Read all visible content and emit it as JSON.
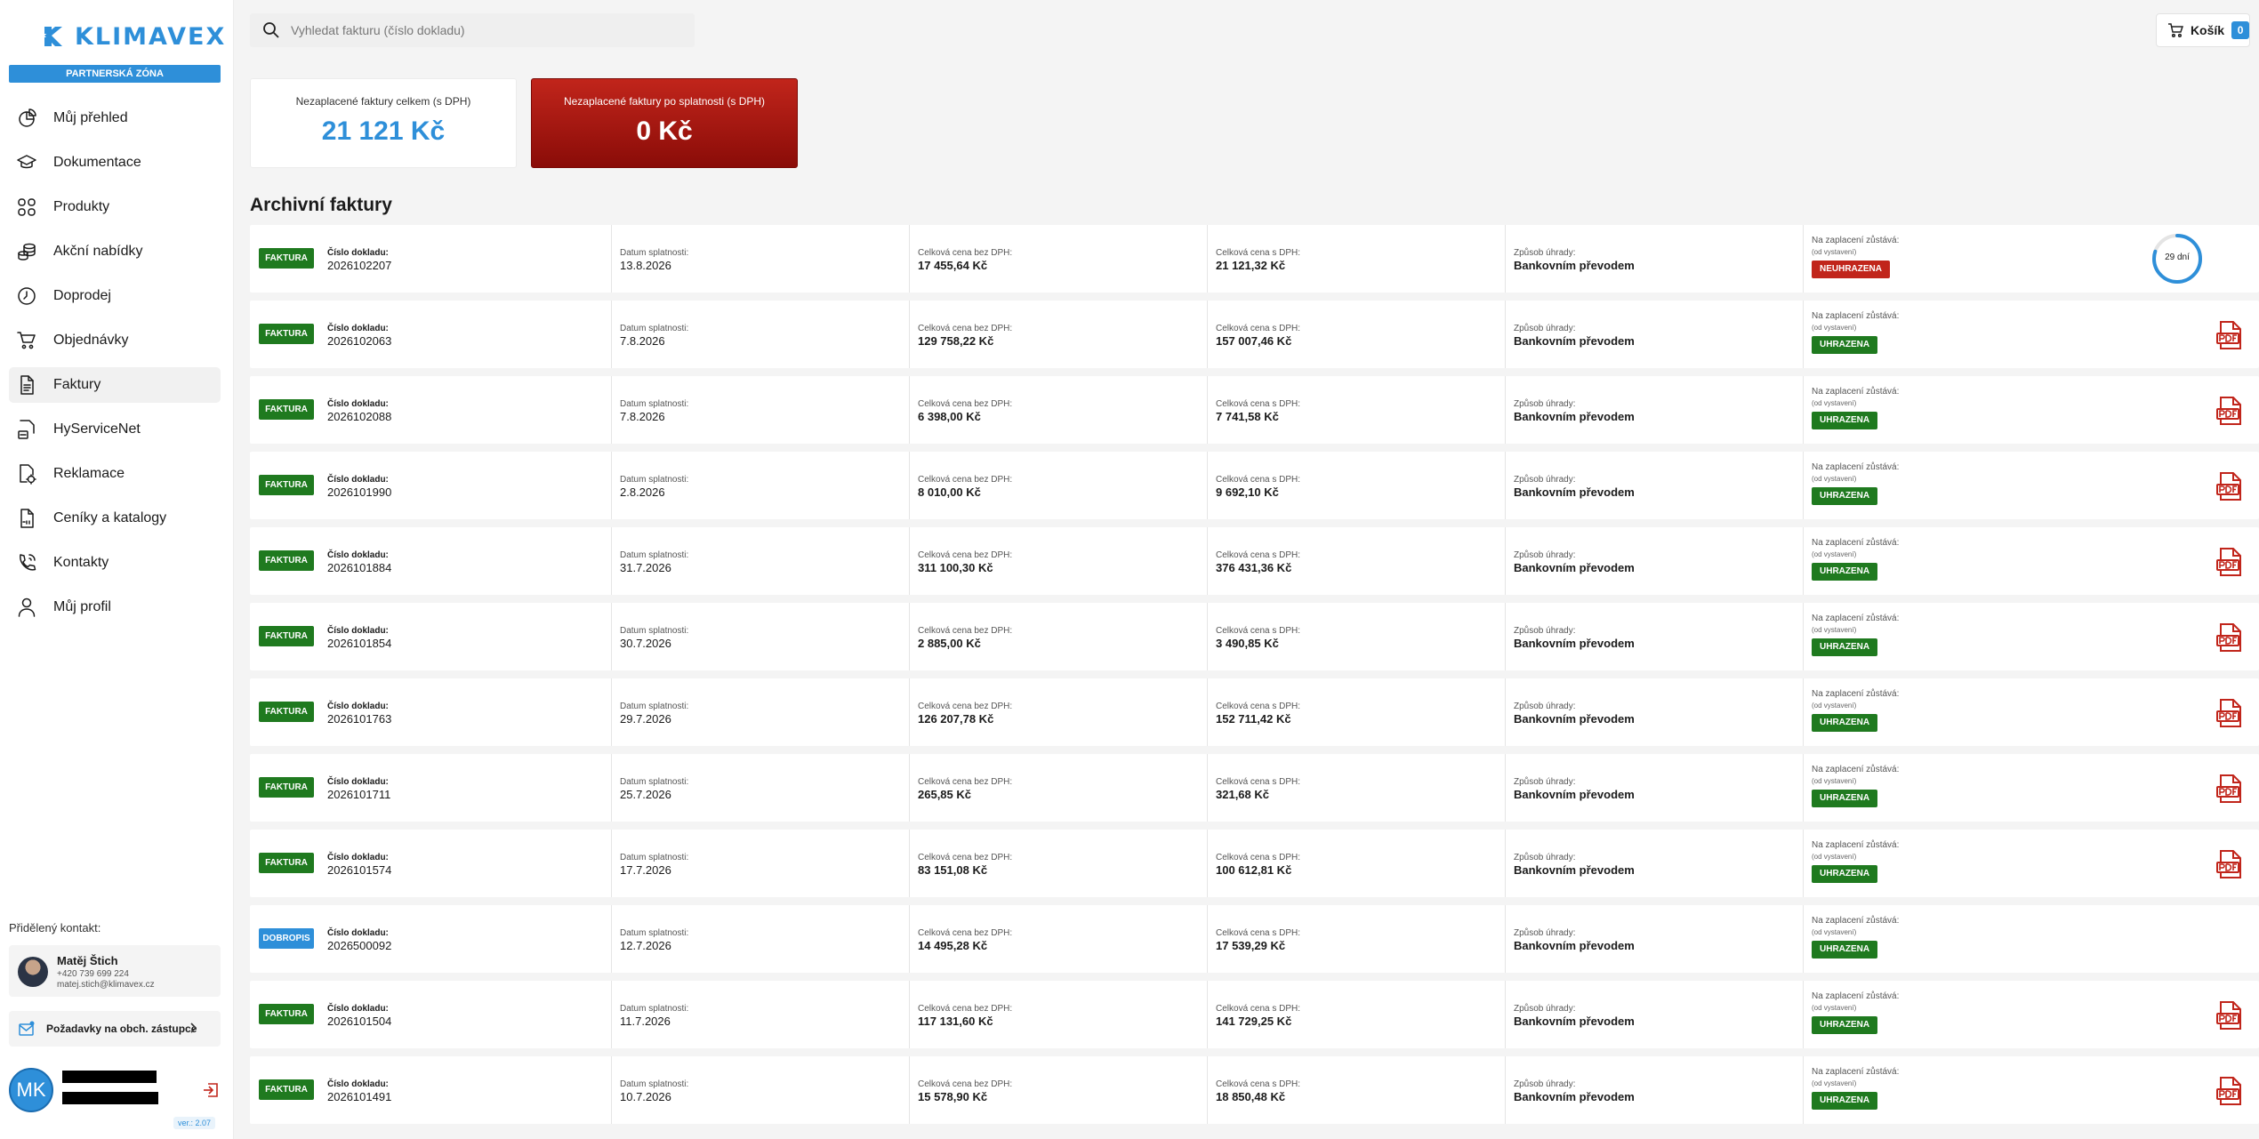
{
  "brand": {
    "name": "KLIMAVEX",
    "zone": "PARTNERSKÁ ZÓNA",
    "accent": "#2e8fd9"
  },
  "nav": [
    {
      "id": "prehled",
      "label": "Můj přehled",
      "icon": "chart-pie-icon"
    },
    {
      "id": "dokumentace",
      "label": "Dokumentace",
      "icon": "graduation-cap-icon"
    },
    {
      "id": "produkty",
      "label": "Produkty",
      "icon": "grid-icon"
    },
    {
      "id": "akce",
      "label": "Akční nabídky",
      "icon": "coins-icon"
    },
    {
      "id": "doprodej",
      "label": "Doprodej",
      "icon": "clock-icon"
    },
    {
      "id": "objednavky",
      "label": "Objednávky",
      "icon": "cart-icon"
    },
    {
      "id": "faktury",
      "label": "Faktury",
      "icon": "document-icon"
    },
    {
      "id": "hyservicenet",
      "label": "HyServiceNet",
      "icon": "globe-icon"
    },
    {
      "id": "reklamace",
      "label": "Reklamace",
      "icon": "document-gear-icon"
    },
    {
      "id": "ceniky",
      "label": "Ceníky a katalogy",
      "icon": "pdf-file-icon"
    },
    {
      "id": "kontakty",
      "label": "Kontakty",
      "icon": "phone-icon"
    },
    {
      "id": "profil",
      "label": "Můj profil",
      "icon": "user-icon"
    }
  ],
  "active_nav": "faktury",
  "contact": {
    "label": "Přidělený kontakt:",
    "name": "Matěj Štich",
    "phone": "+420 739 699 224",
    "email": "matej.stich@klimavex.cz"
  },
  "request_button": "Požadavky na obch. zástupce",
  "user": {
    "initials": "MK"
  },
  "version": "ver.: 2.07",
  "search": {
    "placeholder": "Vyhledat fakturu (číslo dokladu)",
    "value": ""
  },
  "cart": {
    "label": "Košík",
    "count": "0"
  },
  "summary": {
    "unpaid_total_label": "Nezaplacené faktury celkem (s DPH)",
    "unpaid_total_value": "21 121 Kč",
    "overdue_label": "Nezaplacené faktury po splatnosti (s DPH)",
    "overdue_value": "0 Kč"
  },
  "section_title": "Archivní faktury",
  "labels": {
    "number": "Číslo dokladu:",
    "due": "Datum splatnosti:",
    "net": "Celková cena bez DPH:",
    "gross": "Celková cena s DPH:",
    "method": "Způsob úhrady:",
    "remaining": "Na zaplacení zůstává:",
    "remaining_sub": "(od vystavení)"
  },
  "invoices": [
    {
      "type": "FAKTURA",
      "number": "2026102207",
      "due": "13.8.2026",
      "net": "17 455,64 Kč",
      "gross": "21 121,32 Kč",
      "method": "Bankovním převodem",
      "status": "NEUHRAZENA",
      "paid": false,
      "days": "29 dní",
      "days_progress": 0.8
    },
    {
      "type": "FAKTURA",
      "number": "2026102063",
      "due": "7.8.2026",
      "net": "129 758,22 Kč",
      "gross": "157 007,46 Kč",
      "method": "Bankovním převodem",
      "status": "UHRAZENA",
      "paid": true,
      "pdf": true
    },
    {
      "type": "FAKTURA",
      "number": "2026102088",
      "due": "7.8.2026",
      "net": "6 398,00 Kč",
      "gross": "7 741,58 Kč",
      "method": "Bankovním převodem",
      "status": "UHRAZENA",
      "paid": true,
      "pdf": true
    },
    {
      "type": "FAKTURA",
      "number": "2026101990",
      "due": "2.8.2026",
      "net": "8 010,00 Kč",
      "gross": "9 692,10 Kč",
      "method": "Bankovním převodem",
      "status": "UHRAZENA",
      "paid": true,
      "pdf": true
    },
    {
      "type": "FAKTURA",
      "number": "2026101884",
      "due": "31.7.2026",
      "net": "311 100,30 Kč",
      "gross": "376 431,36 Kč",
      "method": "Bankovním převodem",
      "status": "UHRAZENA",
      "paid": true,
      "pdf": true
    },
    {
      "type": "FAKTURA",
      "number": "2026101854",
      "due": "30.7.2026",
      "net": "2 885,00 Kč",
      "gross": "3 490,85 Kč",
      "method": "Bankovním převodem",
      "status": "UHRAZENA",
      "paid": true,
      "pdf": true
    },
    {
      "type": "FAKTURA",
      "number": "2026101763",
      "due": "29.7.2026",
      "net": "126 207,78 Kč",
      "gross": "152 711,42 Kč",
      "method": "Bankovním převodem",
      "status": "UHRAZENA",
      "paid": true,
      "pdf": true
    },
    {
      "type": "FAKTURA",
      "number": "2026101711",
      "due": "25.7.2026",
      "net": "265,85 Kč",
      "gross": "321,68 Kč",
      "method": "Bankovním převodem",
      "status": "UHRAZENA",
      "paid": true,
      "pdf": true
    },
    {
      "type": "FAKTURA",
      "number": "2026101574",
      "due": "17.7.2026",
      "net": "83 151,08 Kč",
      "gross": "100 612,81 Kč",
      "method": "Bankovním převodem",
      "status": "UHRAZENA",
      "paid": true,
      "pdf": true
    },
    {
      "type": "DOBROPIS",
      "number": "2026500092",
      "due": "12.7.2026",
      "net": "14 495,28 Kč",
      "gross": "17 539,29 Kč",
      "method": "Bankovním převodem",
      "status": "UHRAZENA",
      "paid": true,
      "pdf": false
    },
    {
      "type": "FAKTURA",
      "number": "2026101504",
      "due": "11.7.2026",
      "net": "117 131,60 Kč",
      "gross": "141 729,25 Kč",
      "method": "Bankovním převodem",
      "status": "UHRAZENA",
      "paid": true,
      "pdf": true
    },
    {
      "type": "FAKTURA",
      "number": "2026101491",
      "due": "10.7.2026",
      "net": "15 578,90 Kč",
      "gross": "18 850,48 Kč",
      "method": "Bankovním převodem",
      "status": "UHRAZENA",
      "paid": true,
      "pdf": true
    }
  ],
  "icons": {
    "search": "search-icon",
    "cart": "cart-icon",
    "pdf": "pdf-icon",
    "logout": "logout-icon",
    "chevron": "chevron-right-icon",
    "mail": "mail-icon"
  }
}
